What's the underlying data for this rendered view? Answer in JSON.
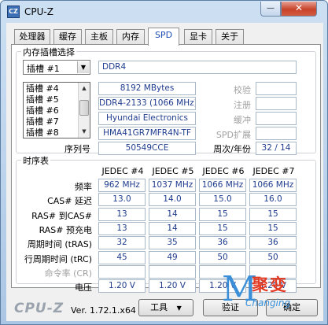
{
  "window": {
    "title": "CPU-Z",
    "icon_text": "CZ",
    "minimize": "—",
    "close": "✕"
  },
  "tabs": [
    {
      "label": "处理器"
    },
    {
      "label": "缓存"
    },
    {
      "label": "主板"
    },
    {
      "label": "内存"
    },
    {
      "label": "SPD"
    },
    {
      "label": "显卡"
    },
    {
      "label": "关于"
    }
  ],
  "slot_group": {
    "label": "内存插槽选择",
    "selected_slot": "插槽 #1",
    "dropdown_items": [
      "插槽 #4",
      "插槽 #5",
      "插槽 #6",
      "插槽 #7",
      "插槽 #8"
    ],
    "type": "DDR4",
    "size": "8192 MBytes",
    "bandwidth": "DDR4-2133 (1066 MHz)",
    "manufacturer": "Hyundai Electronics",
    "part_number": "HMA41GR7MFR4N-TF",
    "serial_label": "序列号",
    "serial": "50549CCE",
    "right_labels": {
      "correction": "校验",
      "registered": "注册",
      "buffered": "缓冲",
      "spd_ext": "SPD扩展",
      "week_year": "周次/年份"
    },
    "week_year": "32 / 14"
  },
  "timing_group": {
    "label": "时序表",
    "columns": [
      "JEDEC #4",
      "JEDEC #5",
      "JEDEC #6",
      "JEDEC #7"
    ],
    "rows": [
      {
        "label": "频率",
        "values": [
          "962 MHz",
          "1037 MHz",
          "1066 MHz",
          "1066 MHz"
        ],
        "gray": false
      },
      {
        "label": "CAS# 延迟",
        "values": [
          "13.0",
          "14.0",
          "15.0",
          "16.0"
        ],
        "gray": false
      },
      {
        "label": "RAS# 到CAS#",
        "values": [
          "13",
          "14",
          "15",
          "15"
        ],
        "gray": false
      },
      {
        "label": "RAS# 预充电",
        "values": [
          "13",
          "14",
          "15",
          "15"
        ],
        "gray": false
      },
      {
        "label": "周期时间 (tRAS)",
        "values": [
          "32",
          "35",
          "36",
          "36"
        ],
        "gray": false
      },
      {
        "label": "行周期时间 (tRC)",
        "values": [
          "45",
          "49",
          "50",
          "50"
        ],
        "gray": false
      },
      {
        "label": "命令率 (CR)",
        "values": [
          "",
          "",
          "",
          ""
        ],
        "gray": true
      },
      {
        "label": "电压",
        "values": [
          "1.20 V",
          "1.20 V",
          "1.20 V",
          "1.20 V"
        ],
        "gray": false
      }
    ]
  },
  "footer": {
    "brand": "CPU-Z",
    "version": "Ver. 1.72.1.x64",
    "tools_button": "工具",
    "tools_arrow": "▼",
    "validate_button": "验证",
    "ok_button": "确定"
  },
  "watermark": {
    "letter": "M",
    "cn": "聚变",
    "en": "Changing"
  }
}
